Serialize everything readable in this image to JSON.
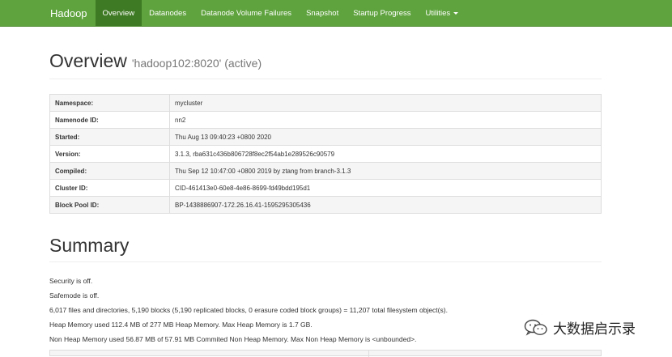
{
  "navbar": {
    "brand": "Hadoop",
    "items": [
      {
        "label": "Overview",
        "active": true
      },
      {
        "label": "Datanodes",
        "active": false
      },
      {
        "label": "Datanode Volume Failures",
        "active": false
      },
      {
        "label": "Snapshot",
        "active": false
      },
      {
        "label": "Startup Progress",
        "active": false
      },
      {
        "label": "Utilities",
        "active": false,
        "dropdown": true
      }
    ]
  },
  "overview": {
    "title": "Overview",
    "subtitle": "'hadoop102:8020' (active)",
    "rows": [
      {
        "key": "Namespace:",
        "value": "mycluster"
      },
      {
        "key": "Namenode ID:",
        "value": "nn2"
      },
      {
        "key": "Started:",
        "value": "Thu Aug 13 09:40:23 +0800 2020"
      },
      {
        "key": "Version:",
        "value": "3.1.3, rba631c436b806728f8ec2f54ab1e289526c90579"
      },
      {
        "key": "Compiled:",
        "value": "Thu Sep 12 10:47:00 +0800 2019 by ztang from branch-3.1.3"
      },
      {
        "key": "Cluster ID:",
        "value": "CID-461413e0-60e8-4e86-8699-fd49bdd195d1"
      },
      {
        "key": "Block Pool ID:",
        "value": "BP-1438886907-172.26.16.41-1595295305436"
      }
    ]
  },
  "summary": {
    "title": "Summary",
    "lines": [
      "Security is off.",
      "Safemode is off.",
      "6,017 files and directories, 5,190 blocks (5,190 replicated blocks, 0 erasure coded block groups) = 11,207 total filesystem object(s).",
      "Heap Memory used 112.4 MB of 277 MB Heap Memory. Max Heap Memory is 1.7 GB.",
      "Non Heap Memory used 56.87 MB of 57.91 MB Commited Non Heap Memory. Max Non Heap Memory is <unbounded>."
    ]
  },
  "watermark": {
    "text": "大数据启示录",
    "icon": "wechat-icon"
  },
  "colors": {
    "navbar_bg": "#5fa33e",
    "navbar_active": "#3e7a23"
  }
}
